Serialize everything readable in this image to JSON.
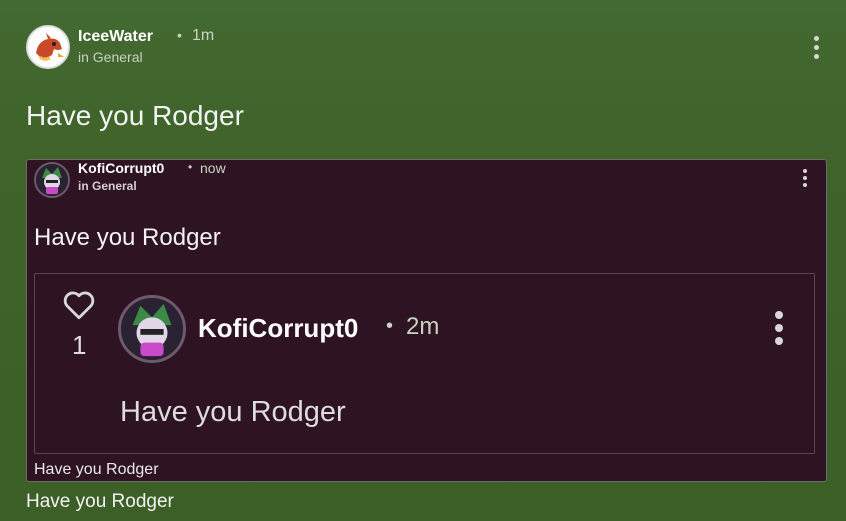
{
  "post": {
    "author": "IceeWater",
    "time": "1m",
    "channel": "in General",
    "title": "Have you Rodger",
    "caption": "Have you Rodger"
  },
  "embed": {
    "author": "KofiCorrupt0",
    "time": "now",
    "channel": "in General",
    "title": "Have you Rodger",
    "footer_text": "Have you Rodger",
    "inner": {
      "like_count": "1",
      "author": "KofiCorrupt0",
      "time": "2m",
      "body": "Have you Rodger"
    }
  },
  "colors": {
    "background": "#3f6329",
    "card": "#2e1422",
    "text": "#f2f2f2"
  },
  "icons": [
    "avatar-dragon",
    "avatar-ralsei",
    "heart-icon",
    "kebab-icon"
  ],
  "separator": "•"
}
